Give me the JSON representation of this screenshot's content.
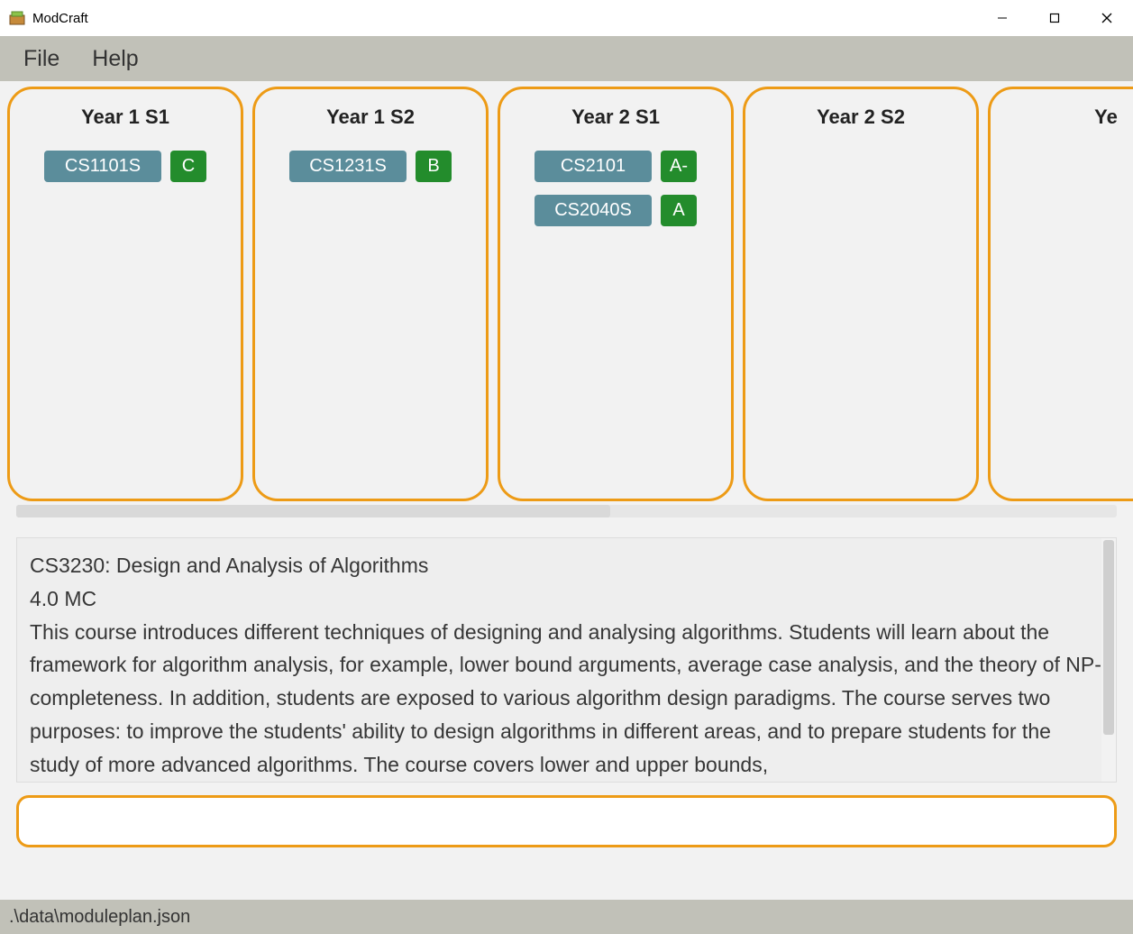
{
  "window": {
    "title": "ModCraft"
  },
  "menu": {
    "file": "File",
    "help": "Help"
  },
  "semesters": [
    {
      "title": "Year 1 S1",
      "modules": [
        {
          "code": "CS1101S",
          "grade": "C"
        }
      ]
    },
    {
      "title": "Year 1 S2",
      "modules": [
        {
          "code": "CS1231S",
          "grade": "B"
        }
      ]
    },
    {
      "title": "Year 2 S1",
      "modules": [
        {
          "code": "CS2101",
          "grade": "A-"
        },
        {
          "code": "CS2040S",
          "grade": "A"
        }
      ]
    },
    {
      "title": "Year 2 S2",
      "modules": []
    },
    {
      "title_partial": "Ye"
    }
  ],
  "output": {
    "line1": "CS3230: Design and Analysis of Algorithms",
    "line2": "4.0 MC",
    "body": "This course introduces different techniques of designing and analysing algorithms. Students will learn about the framework for algorithm analysis, for example, lower bound arguments, average case analysis, and the theory of NP-completeness. In addition, students are exposed to various algorithm design paradigms. The course serves two purposes: to improve the students' ability to design algorithms in different areas, and to prepare students for the study of more advanced algorithms. The course covers lower and upper bounds,"
  },
  "command_input": {
    "value": "",
    "placeholder": ""
  },
  "statusbar": {
    "path": ".\\data\\moduleplan.json"
  }
}
